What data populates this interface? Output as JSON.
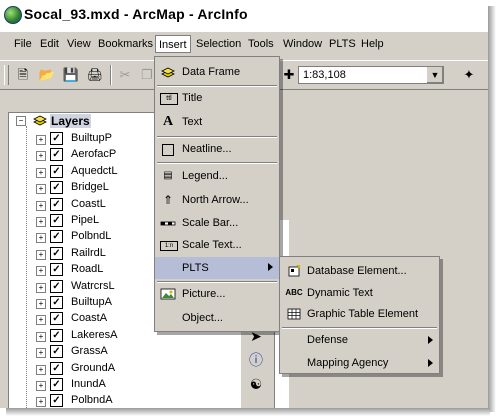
{
  "window": {
    "title": "Socal_93.mxd - ArcMap - ArcInfo"
  },
  "menubar": [
    "File",
    "Edit",
    "View",
    "Bookmarks",
    "Insert",
    "Selection",
    "Tools",
    "Window",
    "PLTS",
    "Help"
  ],
  "toolbar": {
    "scale_value": "1:83,108"
  },
  "toc": {
    "root_label": "Layers",
    "layers": [
      "BuiltupP",
      "AerofacP",
      "AquedctL",
      "BridgeL",
      "CoastL",
      "PipeL",
      "PolbndL",
      "RailrdL",
      "RoadL",
      "WatrcrsL",
      "BuiltupA",
      "CoastA",
      "LakeresA",
      "GrassA",
      "GroundA",
      "InundA",
      "PolbndA"
    ]
  },
  "insert_menu": {
    "items": [
      {
        "label": "Data Frame",
        "icon": "data-frame-icon"
      },
      {
        "label": "Title",
        "icon": "title-icon"
      },
      {
        "label": "Text",
        "icon": "text-icon"
      },
      {
        "label": "Neatline...",
        "icon": "neatline-icon"
      },
      {
        "label": "Legend...",
        "icon": "legend-icon"
      },
      {
        "label": "North Arrow...",
        "icon": "north-arrow-icon"
      },
      {
        "label": "Scale Bar...",
        "icon": "scale-bar-icon"
      },
      {
        "label": "Scale Text...",
        "icon": "scale-text-icon"
      },
      {
        "label": "PLTS",
        "icon": ""
      },
      {
        "label": "Picture...",
        "icon": "picture-icon"
      },
      {
        "label": "Object...",
        "icon": ""
      }
    ]
  },
  "plts_submenu": {
    "items": [
      {
        "label": "Database Element...",
        "icon": "database-element-icon"
      },
      {
        "label": "Dynamic Text",
        "icon": "dynamic-text-icon",
        "glyph": "ABC"
      },
      {
        "label": "Graphic Table Element",
        "icon": "table-icon"
      },
      {
        "label": "Defense",
        "icon": ""
      },
      {
        "label": "Mapping Agency",
        "icon": ""
      }
    ]
  },
  "colors": {
    "face": "#d4d0c8",
    "highlight": "#b5bed6",
    "selected_root": "#cfd4e0"
  }
}
